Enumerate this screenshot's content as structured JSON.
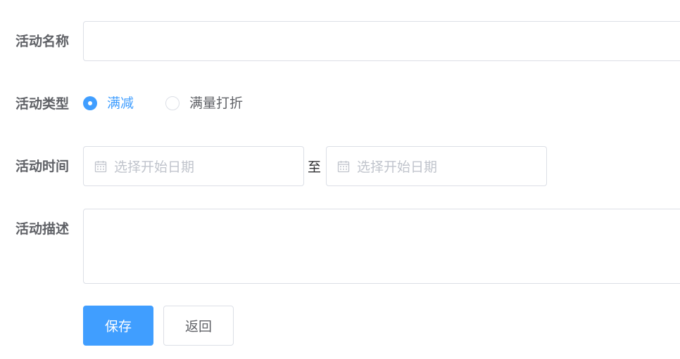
{
  "form": {
    "name": {
      "label": "活动名称",
      "value": ""
    },
    "type": {
      "label": "活动类型",
      "options": [
        "满减",
        "满量打折"
      ],
      "selected": "满减"
    },
    "time": {
      "label": "活动时间",
      "start_placeholder": "选择开始日期",
      "separator": "至",
      "end_placeholder": "选择开始日期"
    },
    "description": {
      "label": "活动描述",
      "value": ""
    }
  },
  "buttons": {
    "save": "保存",
    "back": "返回"
  },
  "icons": {
    "date": "calendar-icon"
  },
  "colors": {
    "primary": "#409eff",
    "border": "#dcdfe6",
    "placeholder": "#c0c4cc",
    "label": "#5f6166"
  }
}
